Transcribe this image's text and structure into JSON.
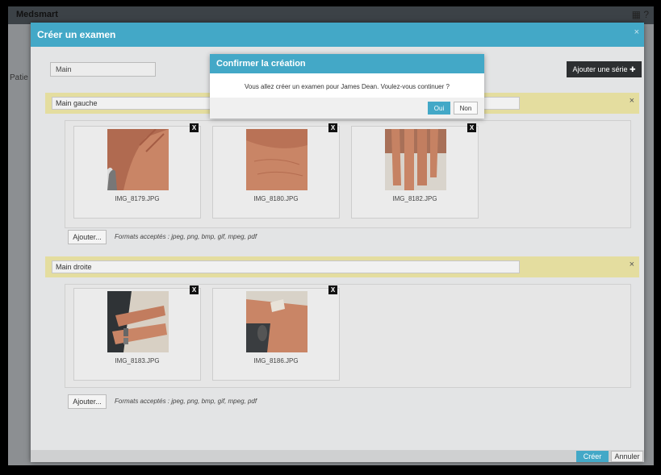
{
  "background": {
    "brand": "Medsmart",
    "icons": [
      "grid-icon",
      "help-icon"
    ],
    "side_label": "Patie"
  },
  "modal": {
    "title": "Créer un examen",
    "close_glyph": "×",
    "exam_name": "Main",
    "add_series_label": "Ajouter une série ✚",
    "create_label": "Créer",
    "cancel_label": "Annuler"
  },
  "series": [
    {
      "name": "Main gauche",
      "remove_glyph": "×",
      "images": [
        {
          "filename": "IMG_8179.JPG",
          "delete_glyph": "X"
        },
        {
          "filename": "IMG_8180.JPG",
          "delete_glyph": "X"
        },
        {
          "filename": "IMG_8182.JPG",
          "delete_glyph": "X"
        }
      ],
      "add_label": "Ajouter...",
      "formats": "Formats acceptés : jpeg, png, bmp, gif, mpeg, pdf"
    },
    {
      "name": "Main droite",
      "remove_glyph": "×",
      "images": [
        {
          "filename": "IMG_8183.JPG",
          "delete_glyph": "X"
        },
        {
          "filename": "IMG_8186.JPG",
          "delete_glyph": "X"
        }
      ],
      "add_label": "Ajouter...",
      "formats": "Formats acceptés : jpeg, png, bmp, gif, mpeg, pdf"
    }
  ],
  "confirm_dialog": {
    "title": "Confirmer la création",
    "message": "Vous allez créer un examen pour James Dean. Voulez-vous continuer ?",
    "yes_label": "Oui",
    "no_label": "Non"
  },
  "colors": {
    "accent": "#43a8c7",
    "series_bar": "#e4dd9f",
    "dark_button": "#2d2f31"
  }
}
